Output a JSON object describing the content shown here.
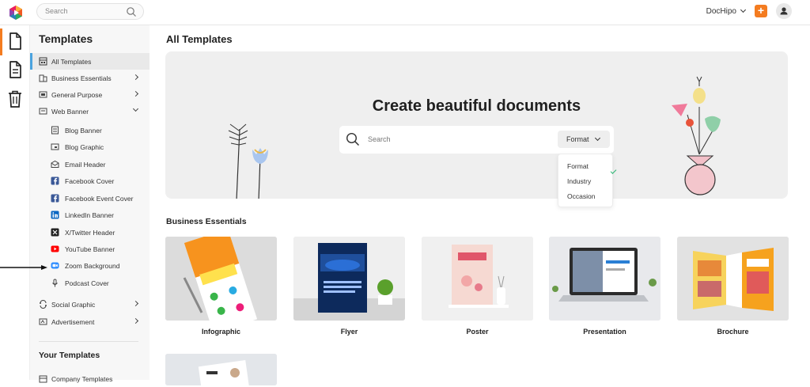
{
  "topbar": {
    "search_placeholder": "Search",
    "account_name": "DocHipo",
    "plus_label": "+"
  },
  "sidebar": {
    "title": "Templates",
    "items": [
      {
        "label": "All Templates",
        "icon": "grid-icon",
        "active": true,
        "indent": false,
        "arrow": ""
      },
      {
        "label": "Business Essentials",
        "icon": "building-icon",
        "indent": false,
        "arrow": "right"
      },
      {
        "label": "General Purpose",
        "icon": "template-icon",
        "indent": false,
        "arrow": "right"
      },
      {
        "label": "Web Banner",
        "icon": "banner-icon",
        "indent": false,
        "arrow": "down"
      },
      {
        "label": "Blog Banner",
        "icon": "blog-banner-icon",
        "indent": true,
        "arrow": ""
      },
      {
        "label": "Blog Graphic",
        "icon": "blog-graphic-icon",
        "indent": true,
        "arrow": ""
      },
      {
        "label": "Email Header",
        "icon": "email-icon",
        "indent": true,
        "arrow": ""
      },
      {
        "label": "Facebook Cover",
        "icon": "facebook-icon",
        "indent": true,
        "arrow": ""
      },
      {
        "label": "Facebook Event Cover",
        "icon": "facebook-icon",
        "indent": true,
        "arrow": ""
      },
      {
        "label": "LinkedIn Banner",
        "icon": "linkedin-icon",
        "indent": true,
        "arrow": ""
      },
      {
        "label": "X/Twitter Header",
        "icon": "x-icon",
        "indent": true,
        "arrow": ""
      },
      {
        "label": "YouTube Banner",
        "icon": "youtube-icon",
        "indent": true,
        "arrow": ""
      },
      {
        "label": "Zoom Background",
        "icon": "zoom-icon",
        "indent": true,
        "arrow": ""
      },
      {
        "label": "Podcast Cover",
        "icon": "microphone-icon",
        "indent": true,
        "arrow": ""
      },
      {
        "label": "Social Graphic",
        "icon": "social-icon",
        "indent": false,
        "arrow": "right"
      },
      {
        "label": "Advertisement",
        "icon": "advertisement-icon",
        "indent": false,
        "arrow": "right"
      }
    ],
    "your_templates_title": "Your Templates",
    "company_templates": "Company Templates"
  },
  "main": {
    "title": "All Templates",
    "hero": {
      "heading": "Create beautiful documents",
      "search_placeholder": "Search",
      "format_label": "Format",
      "dropdown": [
        {
          "label": "Format",
          "checked": true
        },
        {
          "label": "Industry",
          "checked": false
        },
        {
          "label": "Occasion",
          "checked": false
        }
      ]
    },
    "section_title": "Business Essentials",
    "cards": [
      {
        "label": "Infographic"
      },
      {
        "label": "Flyer"
      },
      {
        "label": "Poster"
      },
      {
        "label": "Presentation"
      },
      {
        "label": "Brochure"
      }
    ]
  },
  "colors": {
    "accent": "#f47c20",
    "active_indicator": "#4aa3df",
    "check": "#2bb673"
  }
}
